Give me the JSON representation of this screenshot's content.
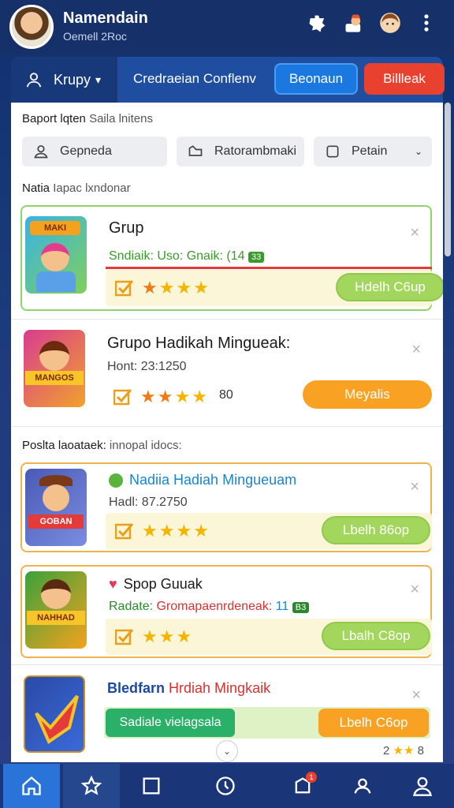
{
  "header": {
    "title": "Namendain",
    "subtitle": "Oemell 2Roc"
  },
  "nav": {
    "group_label": "Krupy",
    "center_label": "Credraeian Conflenv",
    "primary_button": "Beonaun",
    "danger_button": "Billleak"
  },
  "filters": {
    "heading": "Baport lqten",
    "heading_muted": "Saila lnitens",
    "items": [
      "Gepneda",
      "Ratorambmaki",
      "Petain"
    ]
  },
  "section1": {
    "title": "Natia",
    "title_muted": "Iapac lxndonar"
  },
  "section2": {
    "title": "Poslta laoataek:",
    "title_muted": "innopal idocs:"
  },
  "cards": [
    {
      "title": "Grup",
      "sub_prefix": "Sndiaik: Uso: Gnaik:",
      "sub_value": "(14",
      "sub_badge": "33",
      "button": "Hdelh C6up",
      "thumb_text": "MAKI"
    },
    {
      "title": "Grupo Hadikah Mingueak:",
      "sub_prefix": "Hont: 23:1250",
      "rating_value": "80",
      "button": "Meyalis",
      "thumb_text": "MANGOS"
    },
    {
      "title": "Nadiia Hadiah Mingueuam",
      "sub_prefix": "Hadl: 87.2750",
      "button": "Lbelh 86op",
      "thumb_text": "GOBAN"
    },
    {
      "title": "Spop Guuak",
      "sub_prefix": "Radate:",
      "sub_red": "Gromapaenrdeneak:",
      "sub_value": "11",
      "sub_badge": "B3",
      "button": "Lbalh C8op",
      "thumb_text": "NAHHAD"
    },
    {
      "title_blue": "Bledfarn",
      "title_red": "Hrdiah Mingkaik",
      "left_button": "Sadiale vielagsala",
      "button": "Lbelh C6op"
    }
  ],
  "corner_rating": "2",
  "corner_tail": "8",
  "colors": {
    "primary": "#1a78e0",
    "danger": "#e8412f",
    "green": "#a3d65c",
    "orange": "#f8a123",
    "nav_bg": "#16306a"
  },
  "bottom_nav": {
    "items": [
      "home-icon",
      "star-icon",
      "square-icon",
      "clock-icon",
      "bell-icon",
      "users-icon",
      "profile-icon"
    ],
    "badge": "1"
  }
}
